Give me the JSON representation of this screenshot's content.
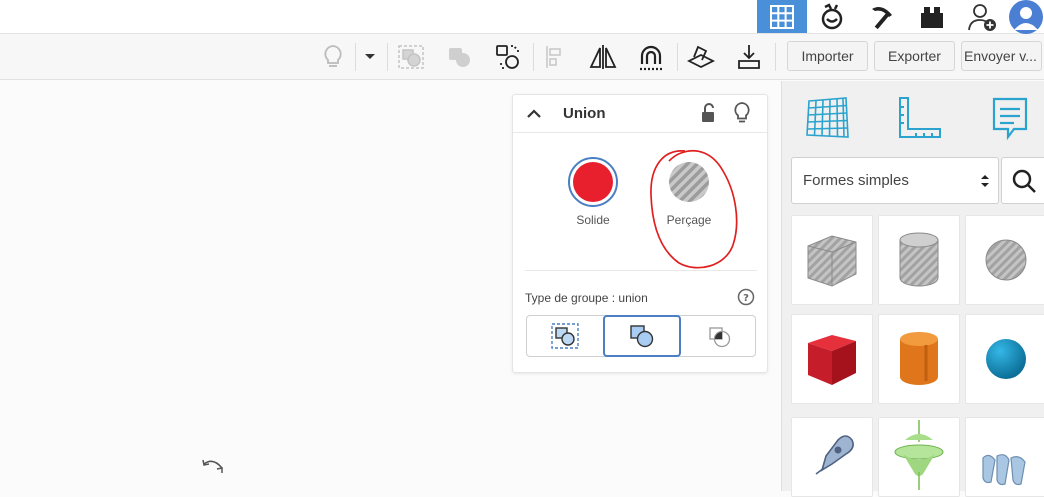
{
  "toolbar": {
    "import_label": "Importer",
    "export_label": "Exporter",
    "send_label": "Envoyer v..."
  },
  "panel": {
    "title": "Union",
    "solid_label": "Solide",
    "hole_label": "Perçage",
    "group_type_label": "Type de groupe : union",
    "help_glyph": "?"
  },
  "library": {
    "category_value": "Formes simples"
  },
  "icons": {
    "topbar": [
      "grid-view-icon",
      "blocks-icon",
      "pickaxe-icon",
      "lego-brick-icon",
      "add-user-icon",
      "avatar"
    ],
    "toolbar": [
      "lightbulb-icon",
      "chevron-down-icon",
      "group-icon",
      "ungroup-icon",
      "duplicate-icon",
      "align-icon",
      "mirror-icon",
      "magnet-icon",
      "workplane-icon",
      "drop-icon"
    ],
    "library": [
      "workplane-grid-icon",
      "ruler-icon",
      "notes-icon"
    ],
    "shapes": [
      "box-hole",
      "cylinder-hole",
      "sphere-hole",
      "box-red",
      "cylinder-orange",
      "sphere-blue",
      "scribble-shape",
      "paraboloid-shape",
      "text-shape"
    ]
  },
  "colors": {
    "accent": "#4a90d9",
    "solid": "#e8202e",
    "annotation": "#e01f1f"
  }
}
